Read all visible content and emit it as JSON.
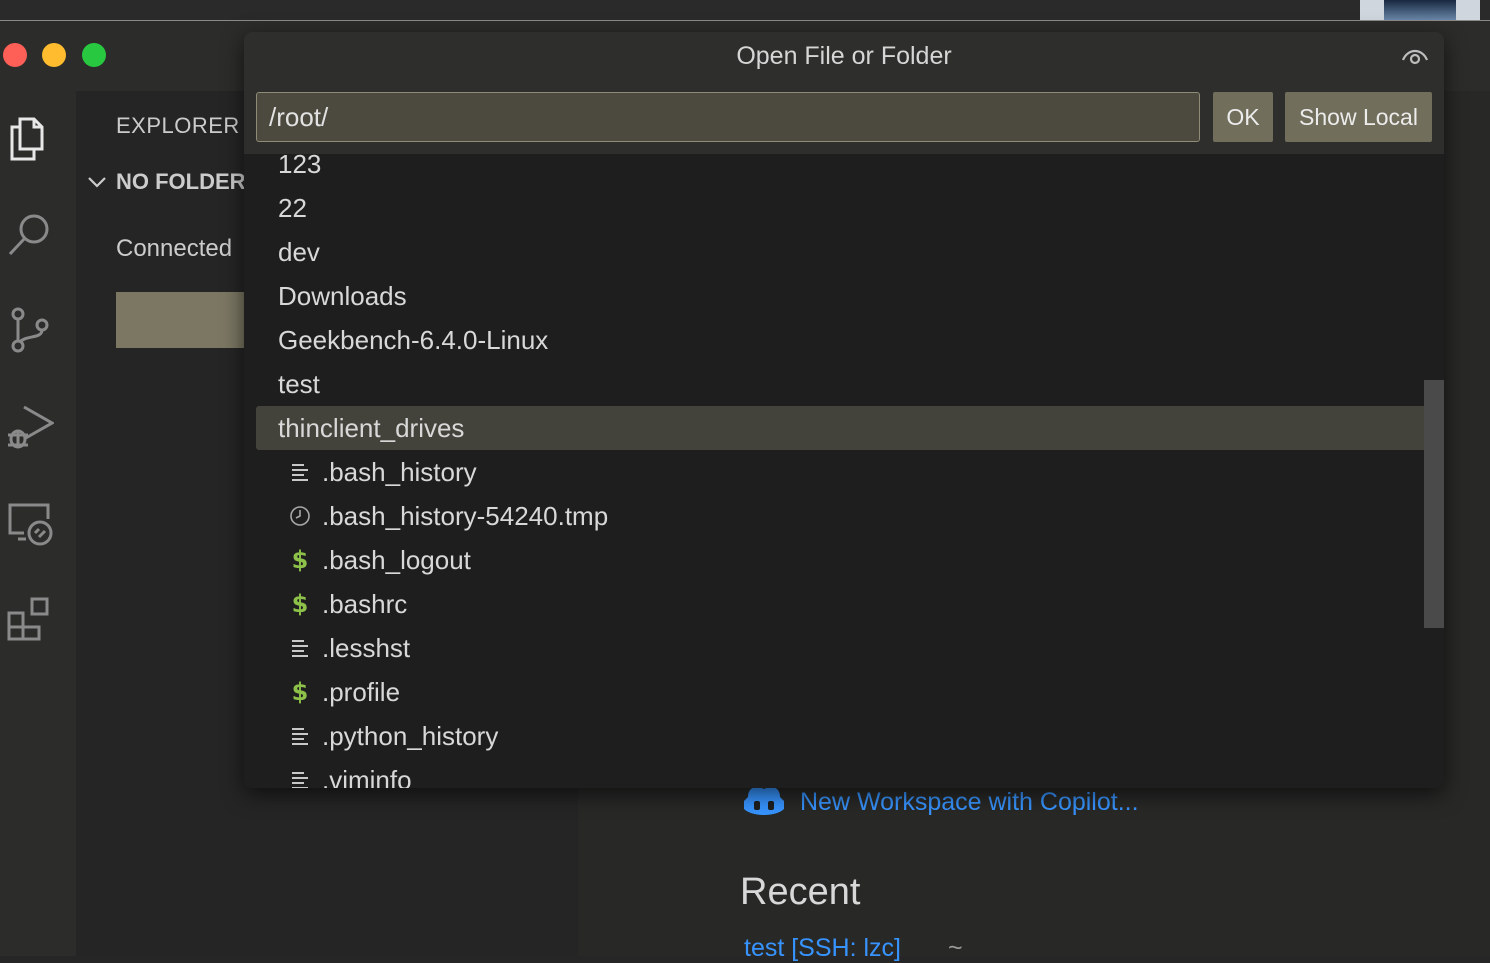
{
  "window": {
    "traffic_lights": [
      "close",
      "minimize",
      "maximize"
    ]
  },
  "activity_bar": {
    "items": [
      {
        "name": "explorer-icon",
        "active": true
      },
      {
        "name": "search-icon"
      },
      {
        "name": "source-control-icon"
      },
      {
        "name": "run-debug-icon"
      },
      {
        "name": "remote-explorer-icon"
      },
      {
        "name": "extensions-icon"
      }
    ]
  },
  "sidebar": {
    "title": "EXPLORER",
    "section": "NO FOLDER",
    "status_text": "Connected"
  },
  "editor": {
    "copilot_link": "New Workspace with Copilot...",
    "recent_heading": "Recent",
    "recent_item": "test [SSH: lzc]",
    "recent_path": "~"
  },
  "dialog": {
    "title": "Open File or Folder",
    "path_value": "/root/",
    "ok_label": "OK",
    "show_local_label": "Show Local",
    "items": [
      {
        "label": "123",
        "kind": "folder"
      },
      {
        "label": "22",
        "kind": "folder"
      },
      {
        "label": "dev",
        "kind": "folder"
      },
      {
        "label": "Downloads",
        "kind": "folder"
      },
      {
        "label": "Geekbench-6.4.0-Linux",
        "kind": "folder"
      },
      {
        "label": "test",
        "kind": "folder"
      },
      {
        "label": "thinclient_drives",
        "kind": "folder",
        "selected": true
      },
      {
        "label": ".bash_history",
        "kind": "file",
        "icon": "lines-icon"
      },
      {
        "label": ".bash_history-54240.tmp",
        "kind": "file",
        "icon": "clock-icon"
      },
      {
        "label": ".bash_logout",
        "kind": "file",
        "icon": "dollar-icon"
      },
      {
        "label": ".bashrc",
        "kind": "file",
        "icon": "dollar-icon"
      },
      {
        "label": ".lesshst",
        "kind": "file",
        "icon": "lines-icon"
      },
      {
        "label": ".profile",
        "kind": "file",
        "icon": "dollar-icon"
      },
      {
        "label": ".python_history",
        "kind": "file",
        "icon": "lines-icon"
      },
      {
        "label": ".viminfo",
        "kind": "file",
        "icon": "lines-icon"
      }
    ]
  },
  "colors": {
    "accent_link": "#3794ff",
    "shell_icon": "#8dc149",
    "selection": "#44433b"
  }
}
